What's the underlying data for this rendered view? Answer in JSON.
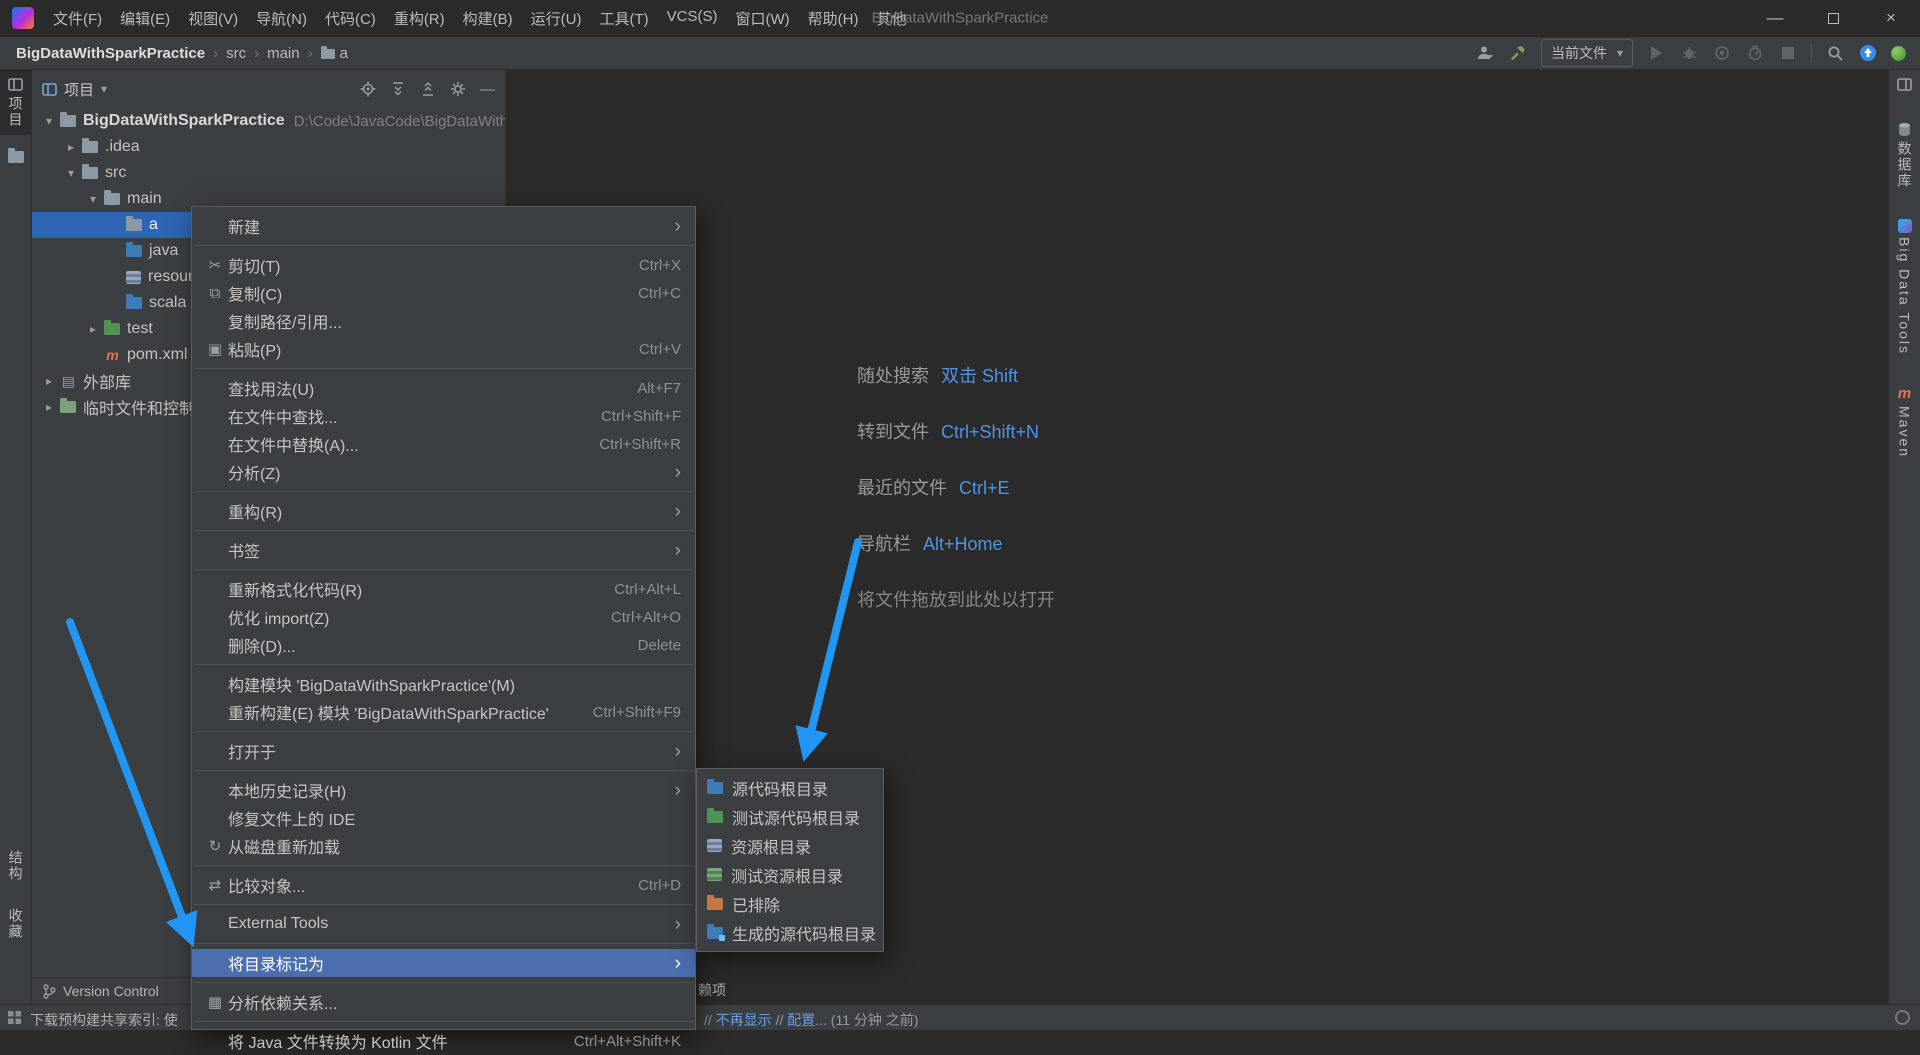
{
  "colors": {
    "titlebar_bg": "#2b2b2b",
    "panel_bg": "#3c3f41",
    "editor_bg": "#2b2b2b",
    "menu_highlight": "#4b6eaf",
    "tree_selection": "#2f65b5",
    "shortcut_blue": "#4e94e8",
    "arrow_blue": "#2196f3",
    "sources_root_blue": "#3e7cb8",
    "test_root_green": "#4f9455",
    "excluded_orange": "#c4784a",
    "maven_orange": "#e8744f"
  },
  "icons": {
    "chevron_down": "▾",
    "chevron_right": "▸",
    "breadcrumb_sep": "›",
    "submenu_arrow": "›",
    "cut": "✂",
    "copy": "⧉",
    "paste": "▣",
    "refresh": "↻",
    "compare": "⇄",
    "deps": "▦",
    "library": "▤",
    "window_min": "—",
    "window_close": "×",
    "panel_min": "—"
  },
  "titlebar": {
    "menus": [
      "文件(F)",
      "编辑(E)",
      "视图(V)",
      "导航(N)",
      "代码(C)",
      "重构(R)",
      "构建(B)",
      "运行(U)",
      "工具(T)",
      "VCS(S)",
      "窗口(W)",
      "帮助(H)",
      "其他"
    ],
    "title": "BigDataWithSparkPractice"
  },
  "navbar": {
    "breadcrumb": [
      "BigDataWithSparkPractice",
      "src",
      "main",
      "a"
    ],
    "run_config": "当前文件"
  },
  "left_strip": {
    "project": "项目",
    "structure": "结构",
    "favorites": "收藏"
  },
  "right_strip": {
    "database": "数据库",
    "big_data_tools": "Big Data Tools",
    "maven": "Maven"
  },
  "project_panel": {
    "header": "项目",
    "tree": [
      {
        "label": "BigDataWithSparkPractice",
        "path": "D:\\Code\\JavaCode\\BigDataWithSparkPractice"
      },
      {
        "label": ".idea"
      },
      {
        "label": "src"
      },
      {
        "label": "main"
      },
      {
        "label": "a"
      },
      {
        "label": "java"
      },
      {
        "label": "resources"
      },
      {
        "label": "scala"
      },
      {
        "label": "test"
      },
      {
        "label": "pom.xml"
      },
      {
        "label": "外部库"
      },
      {
        "label": "临时文件和控制台"
      }
    ]
  },
  "context_menu": {
    "items": [
      {
        "label": "新建",
        "sub": true
      },
      {
        "sep": true
      },
      {
        "label": "剪切(T)",
        "shortcut": "Ctrl+X",
        "icon": "cut"
      },
      {
        "label": "复制(C)",
        "shortcut": "Ctrl+C",
        "icon": "copy"
      },
      {
        "label": "复制路径/引用..."
      },
      {
        "label": "粘贴(P)",
        "shortcut": "Ctrl+V",
        "icon": "paste"
      },
      {
        "sep": true
      },
      {
        "label": "查找用法(U)",
        "shortcut": "Alt+F7"
      },
      {
        "label": "在文件中查找...",
        "shortcut": "Ctrl+Shift+F"
      },
      {
        "label": "在文件中替换(A)...",
        "shortcut": "Ctrl+Shift+R"
      },
      {
        "label": "分析(Z)",
        "sub": true
      },
      {
        "sep": true
      },
      {
        "label": "重构(R)",
        "sub": true
      },
      {
        "sep": true
      },
      {
        "label": "书签",
        "sub": true
      },
      {
        "sep": true
      },
      {
        "label": "重新格式化代码(R)",
        "shortcut": "Ctrl+Alt+L"
      },
      {
        "label": "优化 import(Z)",
        "shortcut": "Ctrl+Alt+O"
      },
      {
        "label": "删除(D)...",
        "shortcut": "Delete"
      },
      {
        "sep": true
      },
      {
        "label": "构建模块 'BigDataWithSparkPractice'(M)"
      },
      {
        "label": "重新构建(E) 模块 'BigDataWithSparkPractice'",
        "shortcut": "Ctrl+Shift+F9"
      },
      {
        "sep": true
      },
      {
        "label": "打开于",
        "sub": true
      },
      {
        "sep": true
      },
      {
        "label": "本地历史记录(H)",
        "sub": true
      },
      {
        "label": "修复文件上的 IDE"
      },
      {
        "label": "从磁盘重新加载",
        "icon": "refresh"
      },
      {
        "sep": true
      },
      {
        "label": "比较对象...",
        "shortcut": "Ctrl+D",
        "icon": "compare"
      },
      {
        "sep": true
      },
      {
        "label": "External Tools",
        "sub": true
      },
      {
        "sep": true
      },
      {
        "label": "将目录标记为",
        "sub": true,
        "highlighted": true
      },
      {
        "sep": true
      },
      {
        "label": "分析依赖关系...",
        "icon": "deps"
      },
      {
        "sep": true
      },
      {
        "label": "将 Java 文件转换为 Kotlin 文件",
        "shortcut": "Ctrl+Alt+Shift+K"
      }
    ]
  },
  "submenu": {
    "items": [
      {
        "label": "源代码根目录"
      },
      {
        "label": "测试源代码根目录"
      },
      {
        "label": "资源根目录"
      },
      {
        "label": "测试资源根目录"
      },
      {
        "label": "已排除"
      },
      {
        "label": "生成的源代码根目录"
      }
    ]
  },
  "editor_hints": {
    "rows": [
      {
        "label": "随处搜索",
        "shortcut": "双击 Shift"
      },
      {
        "label": "转到文件",
        "shortcut": "Ctrl+Shift+N"
      },
      {
        "label": "最近的文件",
        "shortcut": "Ctrl+E"
      },
      {
        "label": "导航栏",
        "shortcut": "Alt+Home"
      }
    ],
    "drop_hint": "将文件拖放到此处以打开"
  },
  "statusbar": {
    "version_control": "Version Control",
    "indexing": "下载预构建共享索引: 使",
    "notify_line1": "赖项",
    "notify_sep": "//",
    "notify_link1": "不再显示",
    "notify_link2": "配置...",
    "notify_time": "(11 分钟 之前)"
  }
}
